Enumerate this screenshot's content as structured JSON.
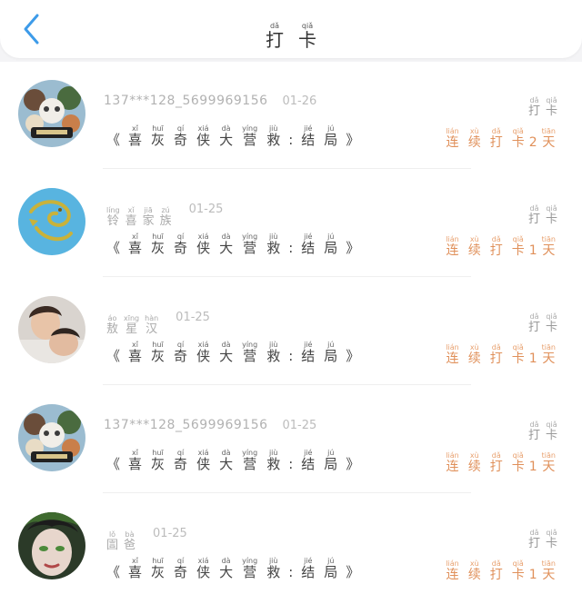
{
  "header": {
    "title": [
      {
        "h": "打",
        "p": "dǎ"
      },
      {
        "h": "卡",
        "p": "qiǎ"
      }
    ]
  },
  "colors": {
    "accent": "#3d9be9",
    "streak": "#e0905a",
    "muted": "#b2b2b2"
  },
  "punch_label": [
    {
      "h": "打",
      "p": "dǎ"
    },
    {
      "h": "卡",
      "p": "qiǎ"
    }
  ],
  "book_title": [
    {
      "h": "《",
      "p": ""
    },
    {
      "h": "喜",
      "p": "xǐ"
    },
    {
      "h": "灰",
      "p": "huī"
    },
    {
      "h": "奇",
      "p": "qí"
    },
    {
      "h": "侠",
      "p": "xiá"
    },
    {
      "h": "大",
      "p": "dà"
    },
    {
      "h": "营",
      "p": "yíng"
    },
    {
      "h": "救",
      "p": "jiù"
    },
    {
      "h": ":",
      "p": ""
    },
    {
      "h": "结",
      "p": "jié"
    },
    {
      "h": "局",
      "p": "jú"
    },
    {
      "h": "》",
      "p": ""
    }
  ],
  "entries": [
    {
      "avatar": "cartoon-avatar",
      "name_text": "137***128_5699969156",
      "date": "01-26",
      "streak": [
        {
          "h": "连",
          "p": "lián"
        },
        {
          "h": "续",
          "p": "xù"
        },
        {
          "h": "打",
          "p": "dǎ"
        },
        {
          "h": "卡",
          "p": "qiǎ"
        },
        {
          "h": "2",
          "p": ""
        },
        {
          "h": "天",
          "p": "tiān"
        }
      ]
    },
    {
      "avatar": "dragon-avatar",
      "name_pinyin": [
        {
          "h": "铃",
          "p": "líng"
        },
        {
          "h": "喜",
          "p": "xǐ"
        },
        {
          "h": "家",
          "p": "jiā"
        },
        {
          "h": "族",
          "p": "zú"
        }
      ],
      "date": "01-25",
      "streak": [
        {
          "h": "连",
          "p": "lián"
        },
        {
          "h": "续",
          "p": "xù"
        },
        {
          "h": "打",
          "p": "dǎ"
        },
        {
          "h": "卡",
          "p": "qiǎ"
        },
        {
          "h": "1",
          "p": ""
        },
        {
          "h": "天",
          "p": "tiān"
        }
      ]
    },
    {
      "avatar": "photo-avatar",
      "name_pinyin": [
        {
          "h": "敖",
          "p": "áo"
        },
        {
          "h": "星",
          "p": "xīng"
        },
        {
          "h": "汉",
          "p": "hàn"
        }
      ],
      "date": "01-25",
      "streak": [
        {
          "h": "连",
          "p": "lián"
        },
        {
          "h": "续",
          "p": "xù"
        },
        {
          "h": "打",
          "p": "dǎ"
        },
        {
          "h": "卡",
          "p": "qiǎ"
        },
        {
          "h": "1",
          "p": ""
        },
        {
          "h": "天",
          "p": "tiān"
        }
      ]
    },
    {
      "avatar": "cartoon-avatar",
      "name_text": "137***128_5699969156",
      "date": "01-25",
      "streak": [
        {
          "h": "连",
          "p": "lián"
        },
        {
          "h": "续",
          "p": "xù"
        },
        {
          "h": "打",
          "p": "dǎ"
        },
        {
          "h": "卡",
          "p": "qiǎ"
        },
        {
          "h": "1",
          "p": ""
        },
        {
          "h": "天",
          "p": "tiān"
        }
      ]
    },
    {
      "avatar": "face-avatar",
      "name_pinyin": [
        {
          "h": "圁",
          "p": "lǒ"
        },
        {
          "h": "爸",
          "p": "bà"
        }
      ],
      "date": "01-25",
      "streak": [
        {
          "h": "连",
          "p": "lián"
        },
        {
          "h": "续",
          "p": "xù"
        },
        {
          "h": "打",
          "p": "dǎ"
        },
        {
          "h": "卡",
          "p": "qiǎ"
        },
        {
          "h": "1",
          "p": ""
        },
        {
          "h": "天",
          "p": "tiān"
        }
      ]
    }
  ]
}
